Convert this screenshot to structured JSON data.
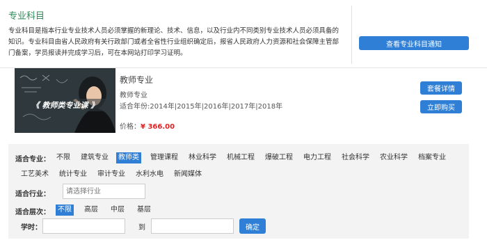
{
  "intro": {
    "title": "专业科目",
    "description": "专业科目是指本行业专业技术人员必须掌握的新理论、技术、信息，以及行业内不同类别专业技术人员必须具备的知识。专业科目由省人民政府有关行政部门或者全省性行业组织确定后，报省人民政府人力资源和社会保障主管部门备案，学员报读并完成学习后，可在本网站打印学习证明。",
    "notice_button": "查看专业科目通知"
  },
  "course": {
    "image_overlay_text": "《 教师类专业课 》",
    "name": "教师专业",
    "category": "教师专业",
    "years_label": "适合年份:",
    "years": "2014年|2015年|2016年|2017年|2018年",
    "price_label": "价格：",
    "price": "¥ 366.00",
    "detail_button": "套餐详情",
    "buy_button": "立即购买"
  },
  "filter": {
    "major_label": "适合专业：",
    "majors": [
      "不限",
      "建筑专业",
      "教师类",
      "管理课程",
      "林业科学",
      "机械工程",
      "爆破工程",
      "电力工程",
      "社会科学",
      "农业科学",
      "档案专业",
      "工艺美术",
      "统计专业",
      "审计专业",
      "水利水电",
      "新闻媒体"
    ],
    "selected_major": "教师类",
    "industry_label": "适合行业：",
    "industry_placeholder": "请选择行业",
    "level_label": "适合层次：",
    "levels": [
      "不限",
      "高层",
      "中层",
      "基层"
    ],
    "selected_level": "不限",
    "hours_label": "学时：",
    "hours_to": "到",
    "confirm_button": "确定"
  },
  "colors": {
    "accent_blue": "#2f7fd6",
    "title_green": "#2e8b57",
    "price_red": "#e02020"
  }
}
